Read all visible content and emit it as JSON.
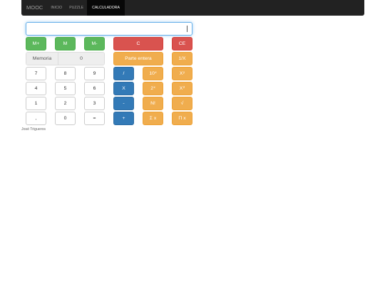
{
  "nav": {
    "brand": "MOOC",
    "links": [
      "INICIO",
      "PUZZLE",
      "CALCULADORA"
    ]
  },
  "display": {
    "value": ""
  },
  "memory": {
    "label": "Memoria",
    "value": "0"
  },
  "buttons": {
    "m_plus": "M+",
    "m": "M",
    "m_minus": "M-",
    "clear": "C",
    "clear_entry": "CE",
    "integer_part": "Parte entera",
    "reciprocal": "1/X",
    "seven": "7",
    "eight": "8",
    "nine": "9",
    "four": "4",
    "five": "5",
    "six": "6",
    "one": "1",
    "two": "2",
    "three": "3",
    "comma": ",",
    "zero": "0",
    "equals": "=",
    "divide": "/",
    "multiply": "X",
    "subtract": "-",
    "add": "+",
    "pow10_base": "10",
    "pow10_exp": "x",
    "pow2_base": "2",
    "pow2_exp": "x",
    "xy_base": "X",
    "xy_exp": "y",
    "x2_base": "X",
    "x2_exp": "2",
    "factorial": "N!",
    "sqrt": "√",
    "sum": "Σ x",
    "product": "Π x"
  },
  "colors": {
    "green": "#5cb85c",
    "red": "#d9534f",
    "orange": "#f0ad4e",
    "blue": "#337ab7"
  },
  "footer": {
    "author": "José Trigueros"
  }
}
